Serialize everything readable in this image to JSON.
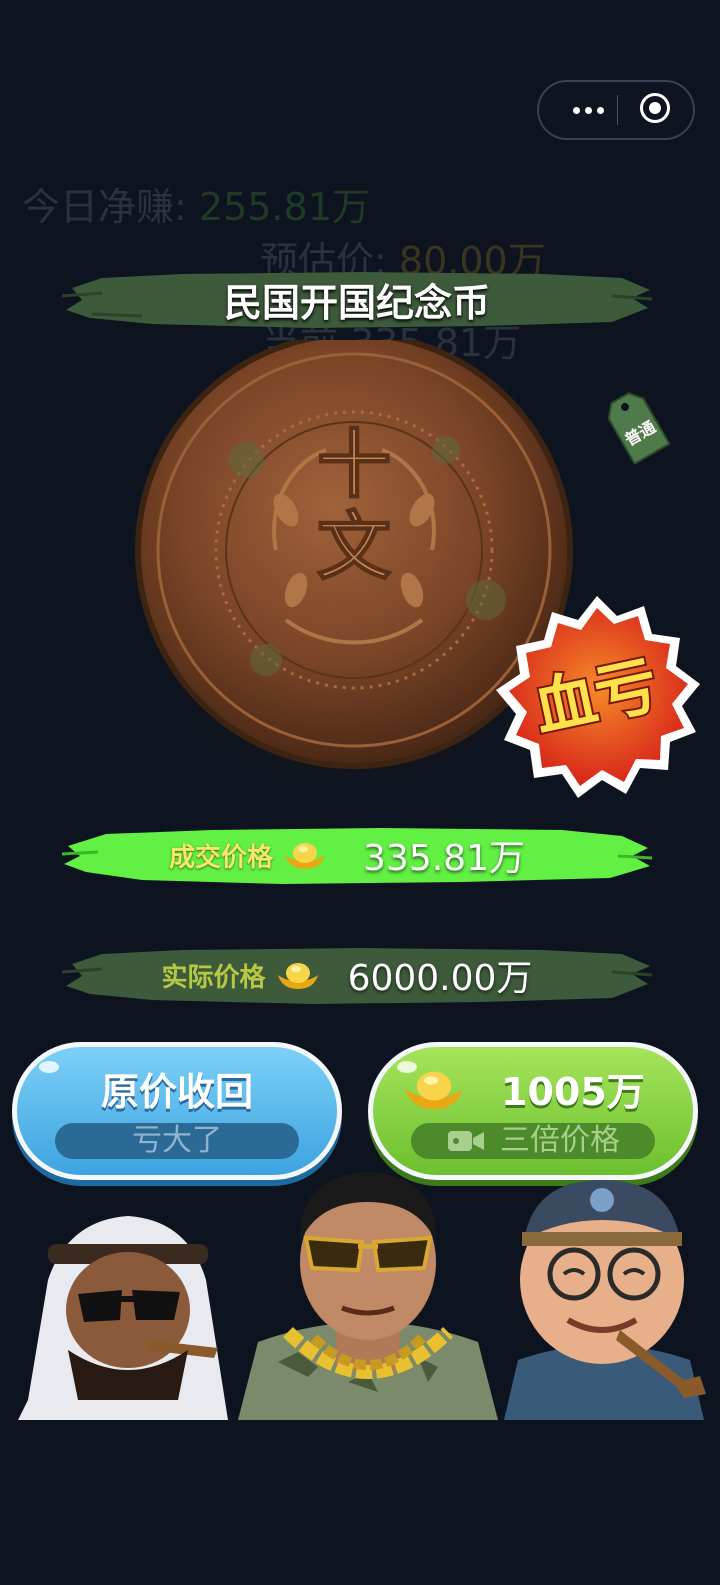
{
  "capsule": {
    "more_icon": "more-dots-icon",
    "close_icon": "target-close-icon"
  },
  "stats": {
    "today_label": "今日净赚:",
    "today_value": "255.81万",
    "estimate_label": "预估价:",
    "estimate_value": "80.00万",
    "current_prefix": "当前",
    "current_value": "335.81万"
  },
  "item": {
    "name": "民国开国纪念币",
    "coin_text_top": "十",
    "coin_text_bottom": "文",
    "tag_text": "普通",
    "stamp_text": "血亏"
  },
  "prices": {
    "deal_label": "成交价格",
    "deal_value": "335.81万",
    "actual_label": "实际价格",
    "actual_value": "6000.00万"
  },
  "buttons": {
    "recover_label": "原价收回",
    "recover_sub": "亏大了",
    "triple_amount": "1005万",
    "triple_sub": "三倍价格"
  },
  "colors": {
    "background": "#0d1420",
    "green_banner": "#61f043",
    "olive_banner": "#3d5a3a",
    "blue_button": "#52b8ec",
    "green_button": "#7ed337",
    "stamp_red": "#e8321a",
    "gold": "#f2c640"
  }
}
